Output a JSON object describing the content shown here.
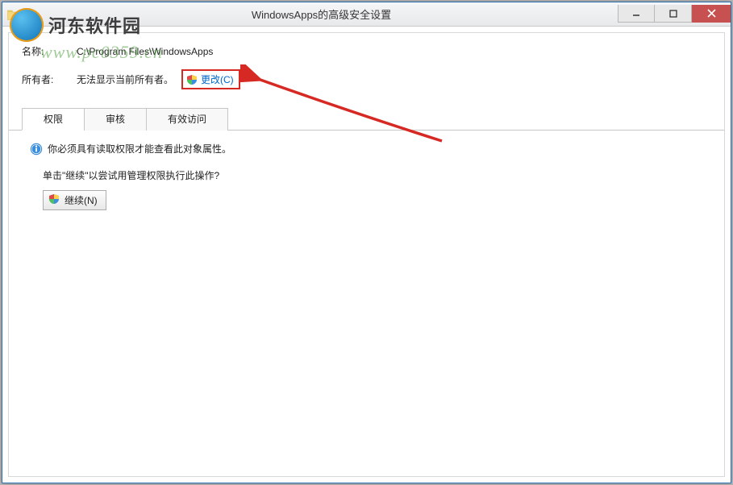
{
  "window": {
    "title": "WindowsApps的高级安全设置"
  },
  "fields": {
    "name_label": "名称:",
    "name_value": "C:\\Program Files\\WindowsApps",
    "owner_label": "所有者:",
    "owner_value": "无法显示当前所有者。",
    "change_link": "更改(C)"
  },
  "tabs": {
    "permissions": "权限",
    "audit": "审核",
    "effective": "有效访问"
  },
  "body": {
    "info_text": "你必须具有读取权限才能查看此对象属性。",
    "prompt_text": "单击\"继续\"以尝试用管理权限执行此操作?",
    "continue_btn": "继续(N)"
  },
  "watermark": {
    "site_name": "河东软件园",
    "site_url": "www.pc0359.cn"
  }
}
